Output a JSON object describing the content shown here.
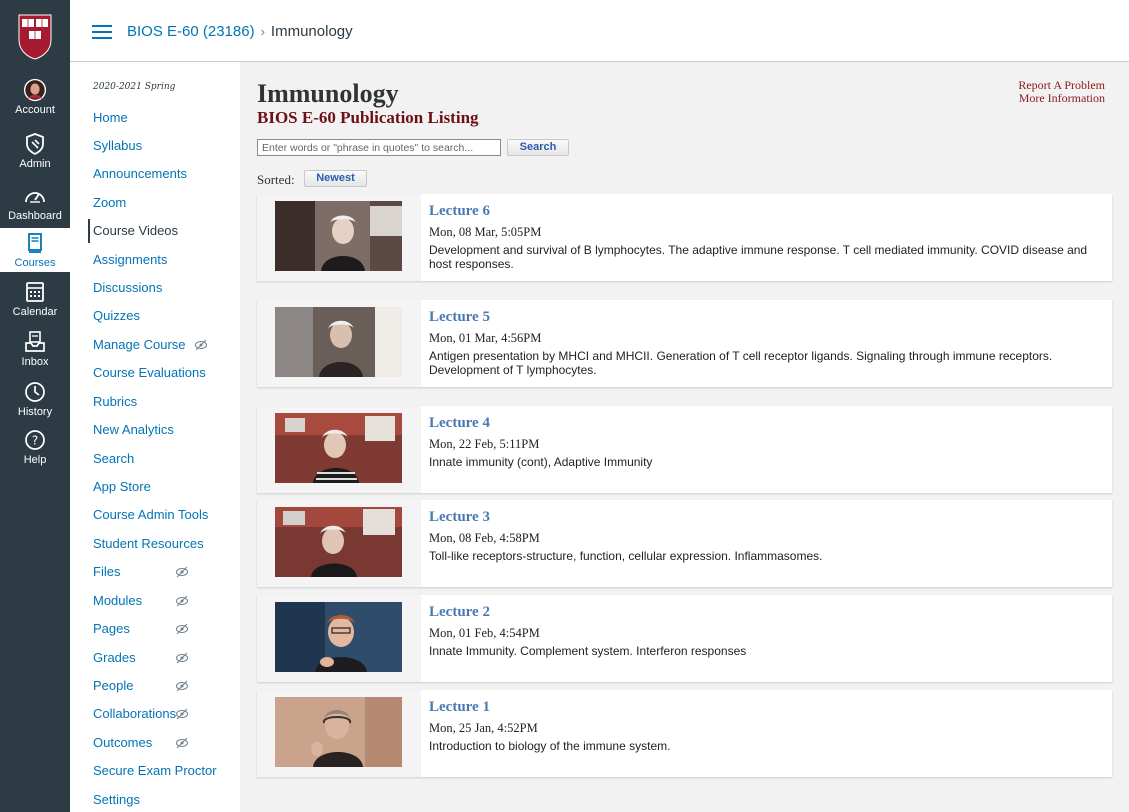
{
  "global_nav": {
    "items": [
      {
        "label": "Account",
        "icon": "avatar"
      },
      {
        "label": "Admin",
        "icon": "shield-icon"
      },
      {
        "label": "Dashboard",
        "icon": "dashboard-icon"
      },
      {
        "label": "Courses",
        "icon": "book-icon",
        "active": true
      },
      {
        "label": "Calendar",
        "icon": "calendar-icon"
      },
      {
        "label": "Inbox",
        "icon": "inbox-icon"
      },
      {
        "label": "History",
        "icon": "clock-icon"
      },
      {
        "label": "Help",
        "icon": "help-icon"
      }
    ],
    "accent": "#0374b5",
    "background": "#2d3b45"
  },
  "breadcrumb": {
    "course": "BIOS E-60 (23186)",
    "separator": "›",
    "current": "Immunology"
  },
  "course_nav": {
    "term": "2020-2021 Spring",
    "items": [
      {
        "label": "Home"
      },
      {
        "label": "Syllabus"
      },
      {
        "label": "Announcements"
      },
      {
        "label": "Zoom"
      },
      {
        "label": "Course Videos",
        "active": true
      },
      {
        "label": "Assignments"
      },
      {
        "label": "Discussions"
      },
      {
        "label": "Quizzes"
      },
      {
        "label": "Manage Course",
        "hidden_icon": true
      },
      {
        "label": "Course Evaluations"
      },
      {
        "label": "Rubrics"
      },
      {
        "label": "New Analytics"
      },
      {
        "label": "Search"
      },
      {
        "label": "App Store"
      },
      {
        "label": "Course Admin Tools"
      },
      {
        "label": "Student Resources"
      },
      {
        "label": "Files",
        "hidden_icon": true
      },
      {
        "label": "Modules",
        "hidden_icon": true
      },
      {
        "label": "Pages",
        "hidden_icon": true
      },
      {
        "label": "Grades",
        "hidden_icon": true
      },
      {
        "label": "People",
        "hidden_icon": true
      },
      {
        "label": "Collaborations",
        "hidden_icon": true
      },
      {
        "label": "Outcomes",
        "hidden_icon": true
      },
      {
        "label": "Secure Exam Proctor"
      },
      {
        "label": "Settings"
      }
    ]
  },
  "main": {
    "title": "Immunology",
    "subtitle": "BIOS E-60 Publication Listing",
    "links": {
      "report": "Report A Problem",
      "more_info": "More Information"
    },
    "search": {
      "placeholder": "Enter words or \"phrase in quotes\" to search...",
      "value": "",
      "button": "Search"
    },
    "sort": {
      "label": "Sorted:",
      "value": "Newest"
    },
    "lectures": [
      {
        "title": "Lecture 6",
        "date": "Mon, 08 Mar, 5:05PM",
        "description": "Development and survival of B lymphocytes. The adaptive immune response. T cell mediated immunity. COVID disease and host responses."
      },
      {
        "title": "Lecture 5",
        "date": "Mon, 01 Mar, 4:56PM",
        "description": "Antigen presentation by MHCI and MHCII. Generation of T cell receptor ligands. Signaling through immune receptors. Development of T lymphocytes."
      },
      {
        "title": "Lecture 4",
        "date": "Mon, 22 Feb, 5:11PM",
        "description": "Innate immunity (cont), Adaptive Immunity"
      },
      {
        "title": "Lecture 3",
        "date": "Mon, 08 Feb, 4:58PM",
        "description": "Toll-like receptors-structure, function, cellular expression. Inflammasomes."
      },
      {
        "title": "Lecture 2",
        "date": "Mon, 01 Feb, 4:54PM",
        "description": "Innate Immunity. Complement system. Interferon responses"
      },
      {
        "title": "Lecture 1",
        "date": "Mon, 25 Jan, 4:52PM",
        "description": "Introduction to biology of the immune system."
      }
    ]
  }
}
